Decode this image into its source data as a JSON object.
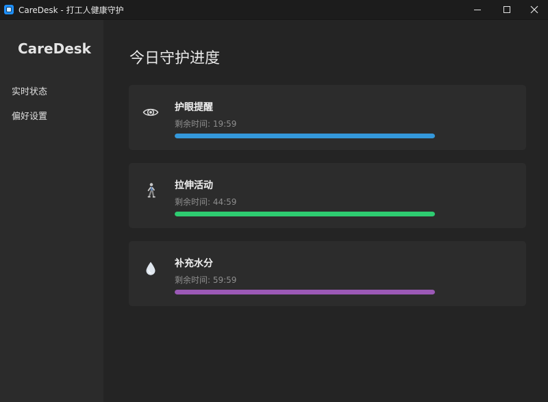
{
  "window": {
    "title": "CareDesk - 打工人健康守护",
    "app_icon": "caredesk-app-icon",
    "buttons": [
      "minimize-icon",
      "maximize-icon",
      "close-icon"
    ]
  },
  "sidebar": {
    "brand": "CareDesk",
    "items": [
      {
        "label": "实时状态"
      },
      {
        "label": "偏好设置"
      }
    ]
  },
  "main": {
    "title": "今日守护进度",
    "cards": [
      {
        "icon": "eye-icon",
        "title": "护眼提醒",
        "remaining": "剩余时间: 19:59",
        "progress": 1.0,
        "color": "#3498db"
      },
      {
        "icon": "walking-person-icon",
        "title": "拉伸活动",
        "remaining": "剩余时间: 44:59",
        "progress": 1.0,
        "color": "#2ecc71"
      },
      {
        "icon": "water-drop-icon",
        "title": "补充水分",
        "remaining": "剩余时间: 59:59",
        "progress": 1.0,
        "color": "#9b59b6"
      }
    ]
  }
}
